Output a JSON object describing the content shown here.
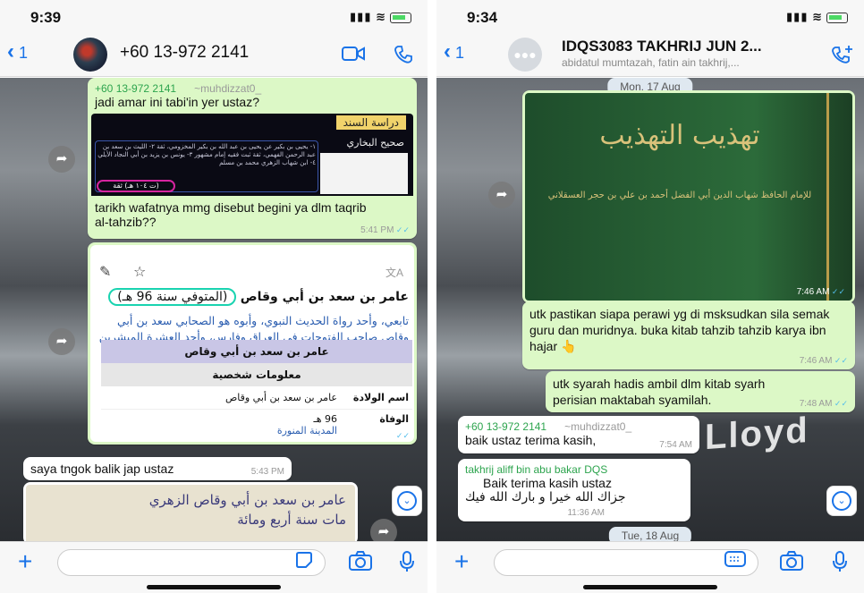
{
  "left": {
    "time": "9:39",
    "nav": {
      "back_count": "1",
      "contact_name": "+60 13-972 2141"
    },
    "messages": {
      "m1": {
        "sender": "+60 13-972 2141",
        "alias": "~muhdizzat0_",
        "text": "jadi amar ini tabi'in yer ustaz?"
      },
      "m1_image": {
        "heading": "دراسة السند",
        "sub": "صحيح البخاري",
        "highlight": "(ت ١٠٤ هـ) ثقة"
      },
      "m2": {
        "text": "tarikh wafatnya mmg disebut begini ya dlm taqrib al-tahzib??",
        "time": "5:41 PM"
      },
      "m3_card": {
        "name_line": "عامر بن سعد بن أبي وقاص",
        "died": "(المتوفي سنة 96 هـ)",
        "body": "تابعي، وأحد رواة الحديث النبوي، وأبوه هو الصحابي سعد بن أبي وقاص صاحب الفتوحات في العراق وفارس، وأحد العشرة المبشرين بالجنة.",
        "table_title": "عامر بن سعد بن أبي وقاص",
        "table_section": "معلومات شخصية",
        "row1_label": "اسم الولادة",
        "row1_value": "عامر بن سعد بن أبي وقاص",
        "row2_label": "الوفاة",
        "row2_value": "96 هـ",
        "row2_place": "المدينة المنورة",
        "time": "5:42 PM"
      },
      "m4": {
        "text": "saya tngok balik jap ustaz",
        "time": "5:43 PM"
      },
      "m5_image": {
        "line1": "عامر بن سعد بن أبي وقاص الزهري",
        "line2": "مات سنة أربع ومائة"
      }
    }
  },
  "right": {
    "time": "9:34",
    "nav": {
      "back_count": "1",
      "group_name": "IDQS3083 TAKHRIJ JUN 2...",
      "members": "abidatul mumtazah, fatin ain takhrij,..."
    },
    "date1": "Mon, 17 Aug",
    "book": {
      "title": "تهذيب التهذيب",
      "subtitle": "للإمام الحافظ شهاب الدين أبي الفضل أحمد بن علي بن حجر العسقلاني",
      "time": "7:46 AM"
    },
    "m1": {
      "text": "utk pastikan siapa perawi yg di msksudkan sila semak guru dan muridnya. buka kitab tahzib tahzib karya ibn hajar 👆",
      "time": "7:46 AM"
    },
    "m2": {
      "text": "utk syarah hadis ambil dlm kitab syarh perisian maktabah syamilah.",
      "time": "7:48 AM"
    },
    "m3": {
      "sender": "+60 13-972 2141",
      "alias": "~muhdizzat0_",
      "text": "baik ustaz terima kasih,",
      "time": "7:54 AM"
    },
    "m4": {
      "sender": "takhrij aliff bin abu bakar DQS",
      "text": "Baik terima kasih ustaz",
      "arabic": "جزاك الله خيرا و بارك الله فيك",
      "time": "11:36 AM"
    },
    "date2": "Tue, 18 Aug",
    "bg_text": "Lloyd"
  },
  "colors": {
    "accent": "#1a73e8",
    "outgoing": "#dcf8c6",
    "incoming": "#ffffff",
    "sender_green": "#2da44e",
    "highlight_cyan": "#19d3b0",
    "highlight_magenta": "#d6249f"
  },
  "icons": [
    "back-chevron",
    "video-icon",
    "phone-icon",
    "add-call-icon",
    "forward-icon",
    "scroll-down-icon",
    "plus-icon",
    "sticker-icon",
    "camera-icon",
    "mic-icon",
    "pencil-icon",
    "star-icon",
    "translate-icon"
  ]
}
